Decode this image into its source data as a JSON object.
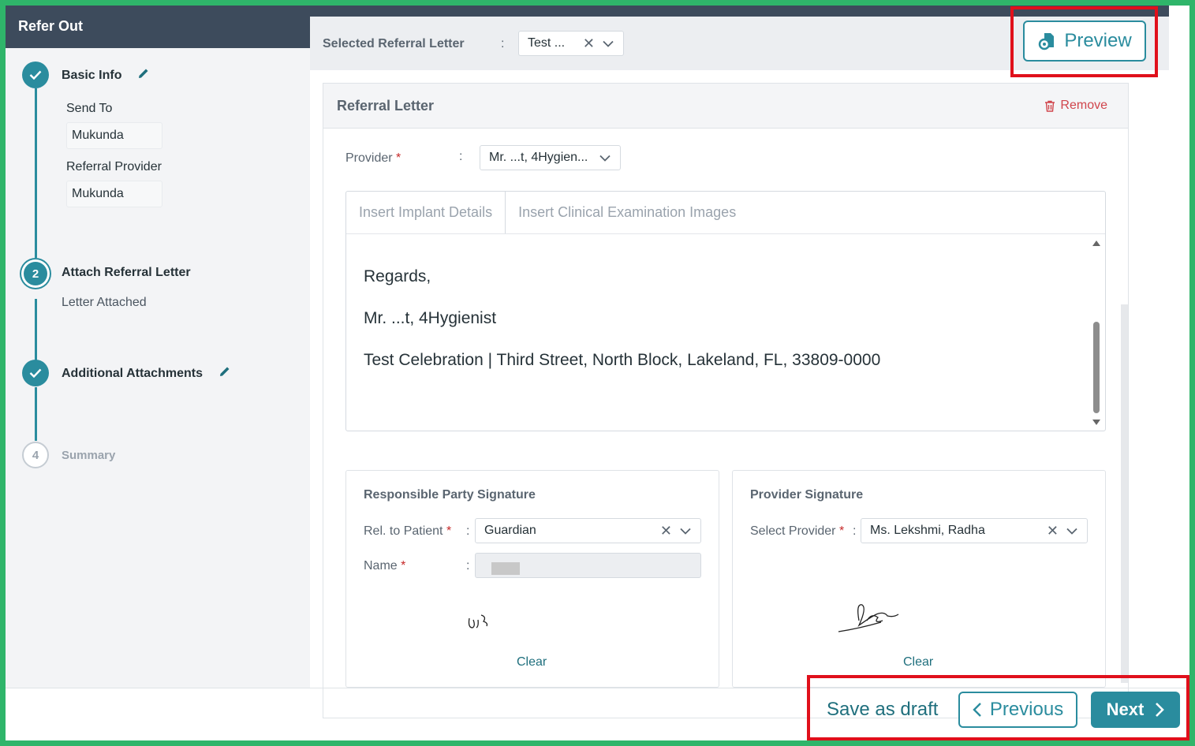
{
  "sidebar": {
    "title": "Refer Out",
    "steps": [
      {
        "number": "",
        "title": "Basic Info",
        "status": "done"
      },
      {
        "number": "2",
        "title": "Attach Referral Letter",
        "status": "active"
      },
      {
        "number": "",
        "title": "Additional Attachments",
        "status": "done"
      },
      {
        "number": "4",
        "title": "Summary",
        "status": "pending"
      }
    ],
    "basic_info": {
      "send_to_label": "Send To",
      "send_to_value": "Mukunda",
      "referral_provider_label": "Referral Provider",
      "referral_provider_value": "Mukunda"
    },
    "letter_attached": "Letter Attached"
  },
  "topbar": {
    "selected_label": "Selected Referral Letter",
    "colon": ":",
    "selected_value": "Test ...",
    "preview_label": "Preview"
  },
  "card": {
    "title": "Referral Letter",
    "remove_label": "Remove",
    "provider_label": "Provider",
    "required_mark": "*",
    "colon": ":",
    "provider_value": "Mr. ...t, 4Hygien...",
    "tabs": [
      "Insert Implant Details",
      "Insert Clinical Examination Images"
    ],
    "letter_lines": [
      "Regards,",
      "Mr. ...t, 4Hygienist",
      "Test Celebration | Third Street, North Block, Lakeland, FL, 33809-0000"
    ]
  },
  "responsible_signature": {
    "title": "Responsible Party Signature",
    "rel_label": "Rel. to Patient",
    "rel_value": "Guardian",
    "name_label": "Name",
    "clear_label": "Clear"
  },
  "provider_signature": {
    "title": "Provider Signature",
    "select_label": "Select Provider",
    "select_value": "Ms. Lekshmi, Radha",
    "clear_label": "Clear"
  },
  "footer": {
    "save_draft_label": "Save as draft",
    "previous_label": "Previous",
    "next_label": "Next"
  },
  "colors": {
    "accent": "#2a8c9e",
    "header": "#3d4b5c",
    "highlight": "#e0101b",
    "border_frame": "#2fb56a"
  }
}
